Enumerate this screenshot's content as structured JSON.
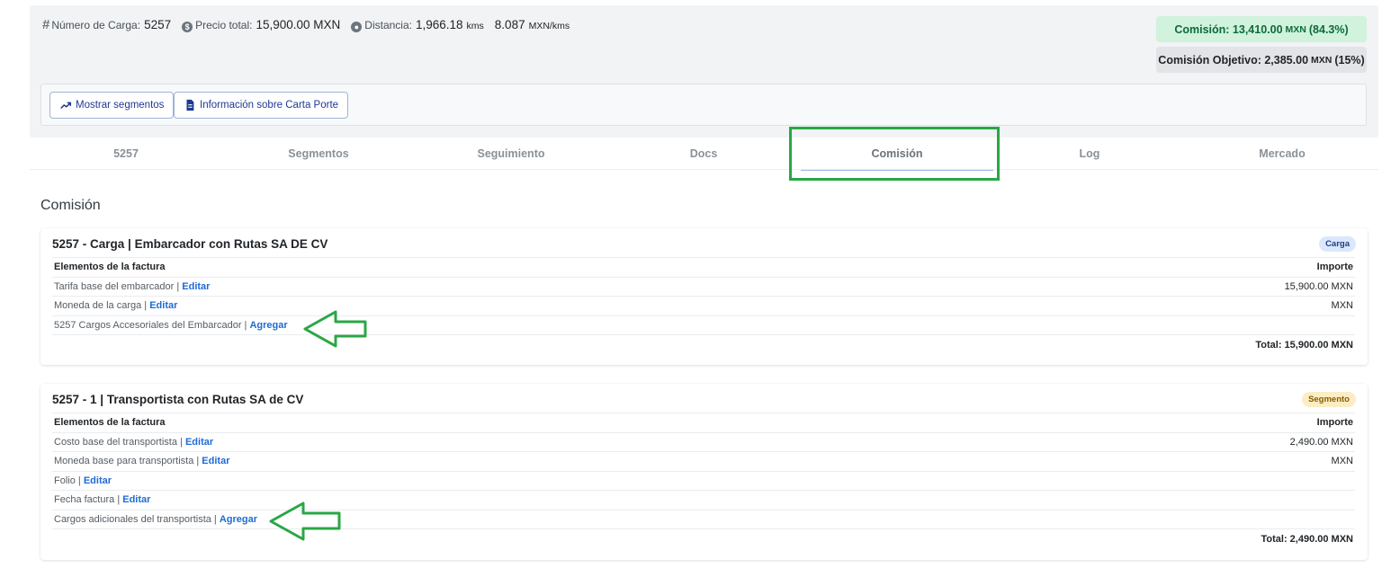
{
  "header": {
    "load_number_label": "Número de Carga:",
    "load_number": "5257",
    "total_price_label": "Precio total:",
    "total_price": "15,900.00 MXN",
    "distance_label": "Distancia:",
    "distance": "1,966.18",
    "distance_unit": "kms",
    "rate": "8.087",
    "rate_unit": "MXN/kms",
    "commission_prefix": "Comisión: 13,410.00",
    "commission_currency": "MXN",
    "commission_pct": "(84.3%)",
    "target_prefix": "Comisión Objetivo: 2,385.00",
    "target_currency": "MXN",
    "target_pct": "(15%)",
    "show_segments_button": "Mostrar segmentos",
    "carta_porte_button": "Información sobre Carta Porte"
  },
  "tabs": [
    "5257",
    "Segmentos",
    "Seguimiento",
    "Docs",
    "Comisión",
    "Log",
    "Mercado"
  ],
  "active_tab": "Comisión",
  "section_title": "Comisión",
  "cards": [
    {
      "title": "5257 - Carga | Embarcador con Rutas SA DE CV",
      "badge": "Carga",
      "col_item": "Elementos de la factura",
      "col_amount": "Importe",
      "rows": [
        {
          "label": "Tarifa base del embarcador |",
          "action": "Editar",
          "amount": "15,900.00 MXN"
        },
        {
          "label": "Moneda de la carga |",
          "action": "Editar",
          "amount": "MXN"
        },
        {
          "label": "5257 Cargos Accesoriales del Embarcador |",
          "action": "Agregar",
          "amount": ""
        }
      ],
      "total": "Total: 15,900.00 MXN"
    },
    {
      "title": "5257 - 1 | Transportista con Rutas SA de CV",
      "badge": "Segmento",
      "col_item": "Elementos de la factura",
      "col_amount": "Importe",
      "rows": [
        {
          "label": "Costo base del transportista |",
          "action": "Editar",
          "amount": "2,490.00 MXN"
        },
        {
          "label": "Moneda base para transportista |",
          "action": "Editar",
          "amount": "MXN"
        },
        {
          "label": "Folio |",
          "action": "Editar",
          "amount": ""
        },
        {
          "label": "Fecha factura |",
          "action": "Editar",
          "amount": ""
        },
        {
          "label": "Cargos adicionales del transportista |",
          "action": "Agregar",
          "amount": ""
        }
      ],
      "total": "Total: 2,490.00 MXN"
    }
  ],
  "colors": {
    "annotation_green": "#29a745",
    "link_blue": "#1f6bd6",
    "commission_bg": "#d1f2dc"
  }
}
